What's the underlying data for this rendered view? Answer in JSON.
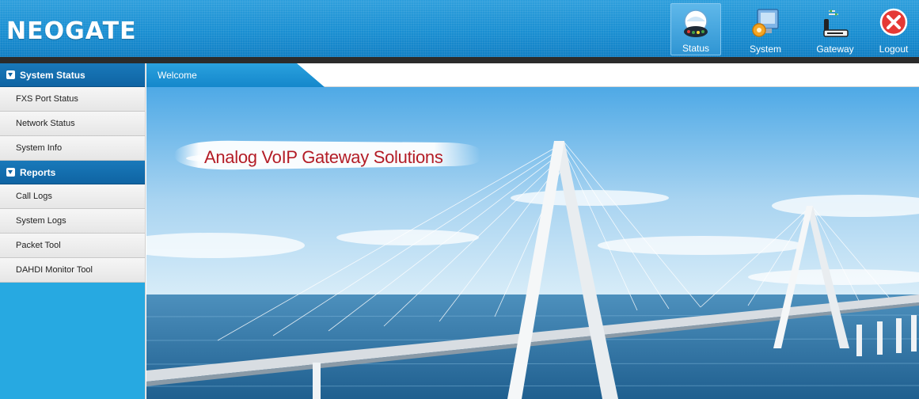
{
  "header": {
    "logo": "NEOGATE",
    "nav": [
      {
        "label": "Status",
        "icon": "status-icon",
        "active": true
      },
      {
        "label": "System",
        "icon": "system-gear-icon",
        "active": false
      },
      {
        "label": "Gateway",
        "icon": "gateway-icon",
        "active": false
      },
      {
        "label": "Logout",
        "icon": "logout-icon",
        "active": false
      }
    ]
  },
  "sidebar": {
    "groups": [
      {
        "title": "System Status",
        "items": [
          "FXS Port Status",
          "Network Status",
          "System Info"
        ]
      },
      {
        "title": "Reports",
        "items": [
          "Call Logs",
          "System Logs",
          "Packet Tool",
          "DAHDI Monitor Tool"
        ]
      }
    ]
  },
  "main": {
    "tab": "Welcome",
    "banner_text": "Analog VoIP Gateway Solutions"
  },
  "colors": {
    "header_blue": "#1a8fd2",
    "sidebar_blue": "#27a9e1",
    "group_head": "#0f64a3",
    "banner_text": "#b31c26"
  }
}
